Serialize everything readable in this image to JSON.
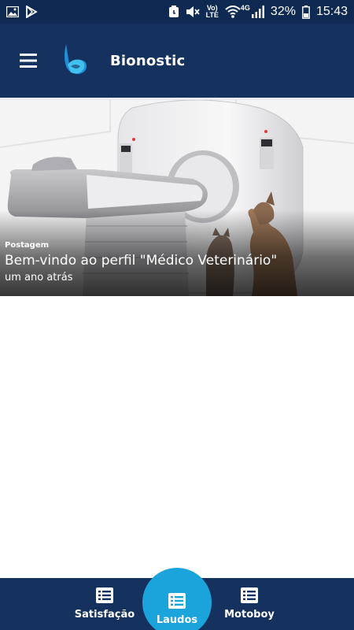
{
  "status_bar": {
    "battery_percent": "32%",
    "time": "15:43",
    "network_label": "4G",
    "volte_label_top": "Vo)",
    "volte_label_bottom": "LTE",
    "icons": [
      "image-icon",
      "play-store-icon",
      "alarm-icon",
      "mute-icon",
      "volte-icon",
      "wifi-icon",
      "signal-icon",
      "battery-icon"
    ]
  },
  "app_bar": {
    "title": "Bionostic",
    "menu_icon": "hamburger-icon",
    "background": "#15325f"
  },
  "hero": {
    "category": "Postagem",
    "title": "Bem-vindo ao perfil \"Médico Veterinário\"",
    "time": "um ano atrás"
  },
  "bottom_nav": {
    "items": [
      {
        "label": "Satisfação",
        "icon": "list-icon",
        "active": false
      },
      {
        "label": "Laudos",
        "icon": "list-icon",
        "active": true
      },
      {
        "label": "Motoboy",
        "icon": "list-icon",
        "active": false
      }
    ],
    "background": "#15325f",
    "accent": "#1ba3db"
  }
}
